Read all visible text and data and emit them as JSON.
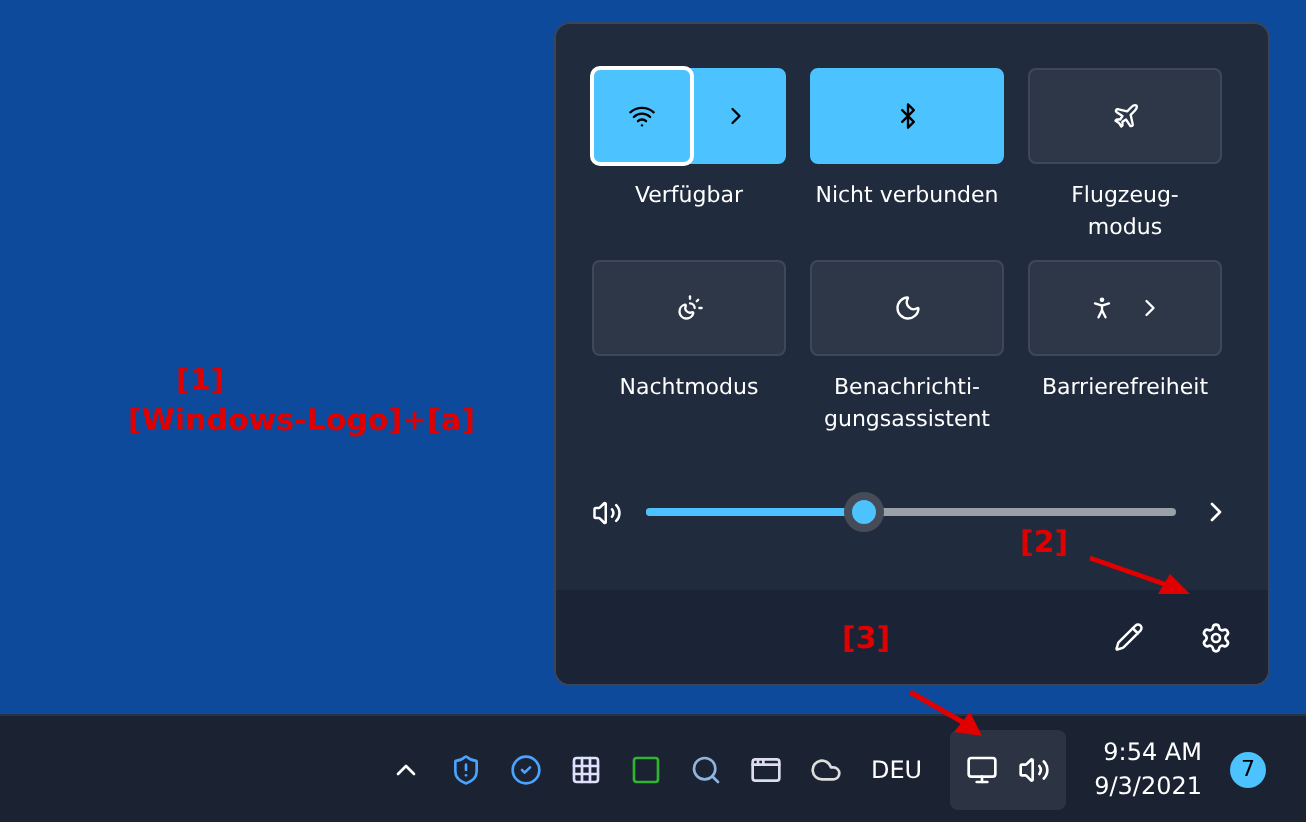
{
  "quick_settings": {
    "tiles": [
      {
        "kind": "split",
        "label": "Verfügbar",
        "on": true,
        "focused": true
      },
      {
        "kind": "single",
        "label": "Nicht verbunden",
        "on": true,
        "focused": false
      },
      {
        "kind": "single",
        "label": "Flugzeug-\nmodus",
        "on": false,
        "focused": false
      },
      {
        "kind": "single",
        "label": "Nachtmodus",
        "on": false,
        "focused": false
      },
      {
        "kind": "single",
        "label": "Benachrichti-\ngungsassistent",
        "on": false,
        "focused": false
      },
      {
        "kind": "expand",
        "label": "Barrierefreiheit",
        "on": false,
        "focused": false
      }
    ],
    "volume": {
      "level": 0.41
    }
  },
  "annotations": [
    {
      "lines": [
        "[1]",
        "[Windows-Logo]+[a]"
      ]
    },
    {
      "lines": [
        "[2]"
      ]
    },
    {
      "lines": [
        "[3]"
      ]
    }
  ],
  "taskbar": {
    "language": "DEU",
    "time": "9:54 AM",
    "date": "9/3/2021",
    "notification_count": "7"
  }
}
